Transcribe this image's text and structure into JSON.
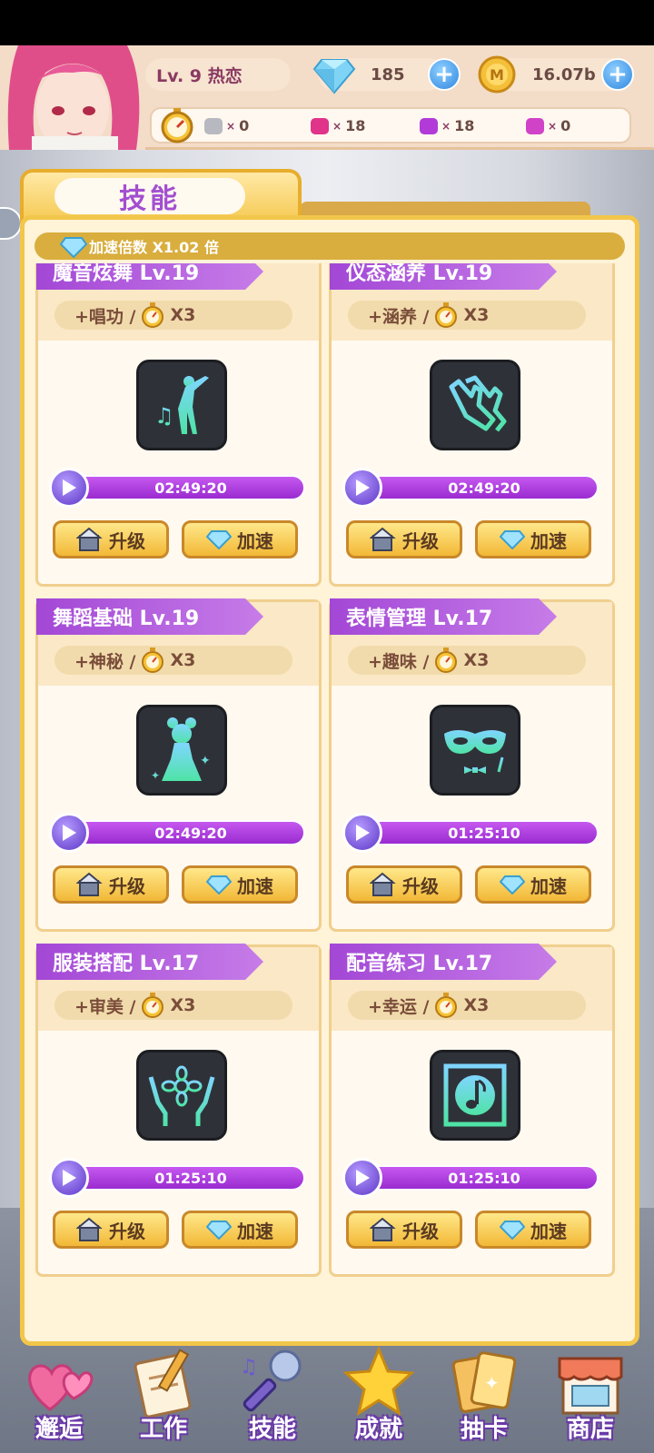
{
  "header": {
    "level_label": "Lv. 9 热恋",
    "diamonds": "185",
    "coins": "16.07b",
    "tickets": [
      {
        "icon": "gray-ticket-icon",
        "color": "#b8b8c0",
        "count": "0"
      },
      {
        "icon": "pink-ticket-icon",
        "color": "#e0338a",
        "count": "18"
      },
      {
        "icon": "purple-ticket-icon",
        "color": "#b23ad8",
        "count": "18"
      },
      {
        "icon": "magenta-ticket-icon",
        "color": "#d043c8",
        "count": "0"
      }
    ],
    "ticket_multiplier": "×"
  },
  "panel": {
    "tab_title": "技能",
    "speed_label": "加速倍数 X1.02 倍"
  },
  "skills": [
    {
      "title": "魔音炫舞 Lv.19",
      "bonus": "+唱功 /",
      "mult": "X3",
      "timer": "02:49:20",
      "icon": "dancer-music-icon"
    },
    {
      "title": "仪态涵养 Lv.19",
      "bonus": "+涵养 /",
      "mult": "X3",
      "timer": "02:49:20",
      "icon": "gloves-icon"
    },
    {
      "title": "舞蹈基础 Lv.19",
      "bonus": "+神秘 /",
      "mult": "X3",
      "timer": "02:49:20",
      "icon": "girl-silhouette-icon"
    },
    {
      "title": "表情管理 Lv.17",
      "bonus": "+趣味 /",
      "mult": "X3",
      "timer": "01:25:10",
      "icon": "mask-bowtie-icon"
    },
    {
      "title": "服装搭配 Lv.17",
      "bonus": "+审美 /",
      "mult": "X3",
      "timer": "01:25:10",
      "icon": "flower-hands-icon"
    },
    {
      "title": "配音练习 Lv.17",
      "bonus": "+幸运 /",
      "mult": "X3",
      "timer": "01:25:10",
      "icon": "music-note-icon"
    }
  ],
  "buttons": {
    "upgrade": "升级",
    "speedup": "加速"
  },
  "nav": [
    {
      "label": "邂逅",
      "icon": "hearts-icon"
    },
    {
      "label": "工作",
      "icon": "notebook-pen-icon"
    },
    {
      "label": "技能",
      "icon": "microphone-icon"
    },
    {
      "label": "成就",
      "icon": "star-icon"
    },
    {
      "label": "抽卡",
      "icon": "cards-icon"
    },
    {
      "label": "商店",
      "icon": "shop-icon"
    }
  ],
  "colors": {
    "accent_purple": "#a347d6",
    "gold": "#f2c64a",
    "blue_plus": "#2f86e0"
  }
}
